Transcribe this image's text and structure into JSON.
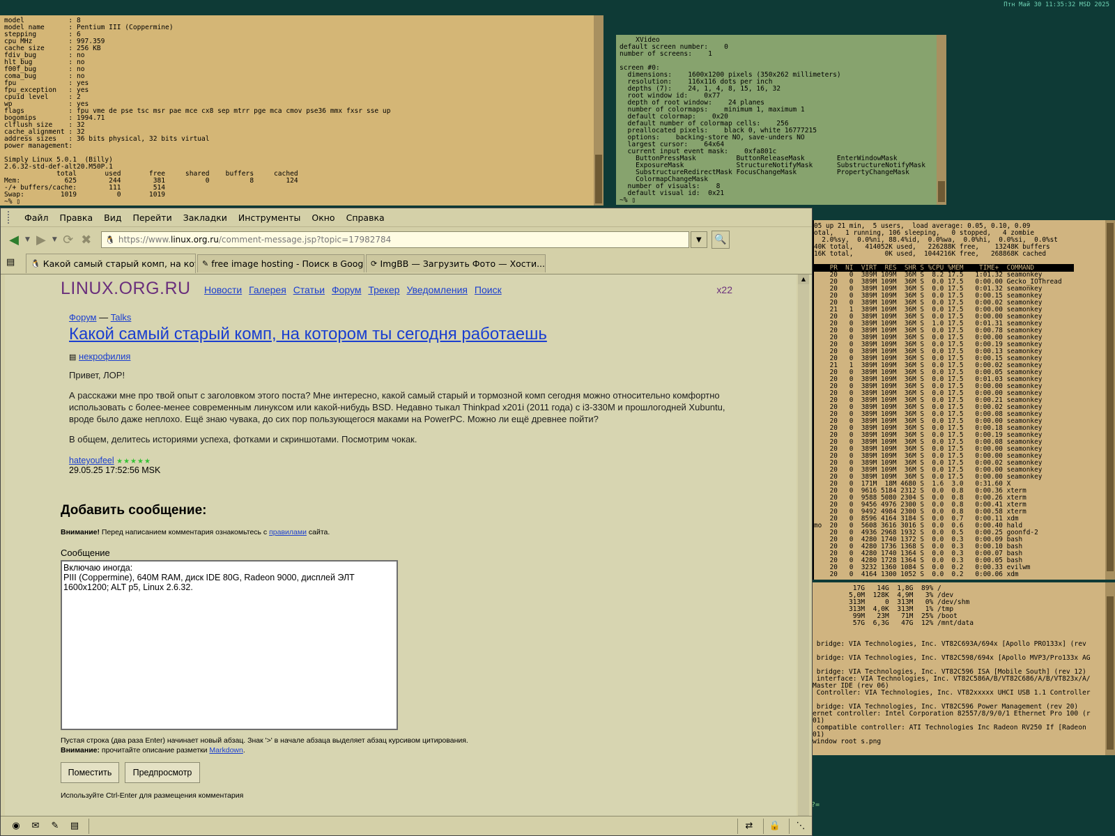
{
  "clock": "Птн Май 30 11:35:32 MSD 2025",
  "term_cpuinfo": {
    "lines": [
      "model           : 8",
      "model name      : Pentium III (Coppermine)",
      "stepping        : 6",
      "cpu MHz         : 997.359",
      "cache size      : 256 KB",
      "fdiv_bug        : no",
      "hlt_bug         : no",
      "f00f_bug        : no",
      "coma_bug        : no",
      "fpu             : yes",
      "fpu_exception   : yes",
      "cpuid level     : 2",
      "wp              : yes",
      "flags           : fpu vme de pse tsc msr pae mce cx8 sep mtrr pge mca cmov pse36 mmx fxsr sse up",
      "bogomips        : 1994.71",
      "clflush size    : 32",
      "cache_alignment : 32",
      "address sizes   : 36 bits physical, 32 bits virtual",
      "power management:",
      "",
      "Simply Linux 5.0.1  (Billy)",
      "2.6.32-std-def-alt20.M50P.1",
      "             total       used       free     shared    buffers     cached",
      "Mem:           625        244        381          0          8        124",
      "-/+ buffers/cache:        111        514",
      "Swap:         1019          0       1019",
      "~% ▯"
    ]
  },
  "term_xdpyinfo": {
    "lines": [
      "    XVideo",
      "default screen number:    0",
      "number of screens:    1",
      "",
      "screen #0:",
      "  dimensions:    1600x1200 pixels (350x262 millimeters)",
      "  resolution:    116x116 dots per inch",
      "  depths (7):    24, 1, 4, 8, 15, 16, 32",
      "  root window id:    0x77",
      "  depth of root window:    24 planes",
      "  number of colormaps:    minimum 1, maximum 1",
      "  default colormap:    0x20",
      "  default number of colormap cells:    256",
      "  preallocated pixels:    black 0, white 16777215",
      "  options:    backing-store NO, save-unders NO",
      "  largest cursor:    64x64",
      "  current input event mask:    0xfa801c",
      "    ButtonPressMask          ButtonReleaseMask        EnterWindowMask",
      "    ExposureMask             StructureNotifyMask      SubstructureNotifyMask",
      "    SubstructureRedirectMask FocusChangeMask          PropertyChangeMask",
      "    ColormapChangeMask",
      "  number of visuals:    8",
      "  default visual id:  0x21",
      "~% ▯"
    ]
  },
  "term_top": {
    "summary": [
      "05 up 21 min,  5 users,  load average: 0.05, 0.10, 0.09",
      "otal,   1 running, 106 sleeping,   0 stopped,   4 zombie",
      "  2.0%sy,  0.0%ni, 88.4%id,  0.0%wa,  0.0%hi,  0.0%si,  0.0%st",
      "40K total,   414052K used,   226288K free,    13248K buffers",
      "16K total,        0K used,  1044216K free,   268868K cached",
      ""
    ],
    "header": "    PR  NI  VIRT  RES  SHR S %CPU %MEM    TIME+  COMMAND          ",
    "rows": [
      "    20   0  389M 109M  36M S  8.2 17.5   1:01.32 seamonkey",
      "    20   0  389M 109M  36M S  0.0 17.5   0:00.00 Gecko_IOThread",
      "    20   0  389M 109M  36M S  0.0 17.5   0:01.32 seamonkey",
      "    20   0  389M 109M  36M S  0.0 17.5   0:00.15 seamonkey",
      "    20   0  389M 109M  36M S  0.0 17.5   0:00.02 seamonkey",
      "    21   1  389M 109M  36M S  0.0 17.5   0:00.00 seamonkey",
      "    20   0  389M 109M  36M S  0.0 17.5   0:00.00 seamonkey",
      "    20   0  389M 109M  36M S  1.0 17.5   0:01.31 seamonkey",
      "    20   0  389M 109M  36M S  0.0 17.5   0:00.78 seamonkey",
      "    20   0  389M 109M  36M S  0.0 17.5   0:00.00 seamonkey",
      "    20   0  389M 109M  36M S  0.0 17.5   0:00.19 seamonkey",
      "    20   0  389M 109M  36M S  0.0 17.5   0:00.13 seamonkey",
      "    20   0  389M 109M  36M S  0.0 17.5   0:00.15 seamonkey",
      "    21   1  389M 109M  36M S  0.0 17.5   0:00.02 seamonkey",
      "    20   0  389M 109M  36M S  0.0 17.5   0:00.05 seamonkey",
      "    20   0  389M 109M  36M S  0.0 17.5   0:01.03 seamonkey",
      "    20   0  389M 109M  36M S  0.0 17.5   0:00.00 seamonkey",
      "    20   0  389M 109M  36M S  0.0 17.5   0:00.00 seamonkey",
      "    20   0  389M 109M  36M S  0.0 17.5   0:00.21 seamonkey",
      "    20   0  389M 109M  36M S  0.0 17.5   0:00.02 seamonkey",
      "    20   0  389M 109M  36M S  0.0 17.5   0:00.08 seamonkey",
      "    20   0  389M 109M  36M S  0.0 17.5   0:00.00 seamonkey",
      "    20   0  389M 109M  36M S  0.0 17.5   0:00.18 seamonkey",
      "    20   0  389M 109M  36M S  0.0 17.5   0:00.19 seamonkey",
      "    20   0  389M 109M  36M S  0.0 17.5   0:00.08 seamonkey",
      "    20   0  389M 109M  36M S  0.0 17.5   0:00.00 seamonkey",
      "    20   0  389M 109M  36M S  0.0 17.5   0:00.00 seamonkey",
      "    20   0  389M 109M  36M S  0.0 17.5   0:00.02 seamonkey",
      "    20   0  389M 109M  36M S  0.0 17.5   0:00.00 seamonkey",
      "    20   0  389M 109M  36M S  0.0 17.5   0:00.00 seamonkey",
      "    20   0  171M  18M 4680 S  1.6  3.0   0:31.60 X",
      "    20   0  9616 5184 2312 S  0.0  0.8   0:00.36 xterm",
      "    20   0  9588 5080 2304 S  0.0  0.8   0:00.26 xterm",
      "    20   0  9456 4976 2300 S  0.0  0.8   0:00.41 xterm",
      "    20   0  9492 4984 2300 S  0.0  0.8   0:00.58 xterm",
      "    20   0  8596 4164 3184 S  0.0  0.7   0:00.11 xdm",
      "mo  20   0  5608 3616 3016 S  0.0  0.6   0:00.40 hald",
      "    20   0  4936 2968 1932 S  0.0  0.5   0:00.25 goonfd-2",
      "    20   0  4280 1740 1372 S  0.0  0.3   0:00.09 bash",
      "    20   0  4280 1736 1368 S  0.0  0.3   0:00.10 bash",
      "    20   0  4280 1740 1364 S  0.0  0.3   0:00.07 bash",
      "    20   0  4280 1728 1364 S  0.0  0.3   0:00.05 bash",
      "    20   0  3232 1360 1084 S  0.0  0.2   0:00.33 evilwm",
      "    20   0  4164 1300 1052 S  0.0  0.2   0:00.06 xdm"
    ]
  },
  "term_misc": {
    "lines": [
      "          17G   14G  1,8G  89% /",
      "         5,0M  128K  4,9M   3% /dev",
      "         313M     0  313M   0% /dev/shm",
      "         313M  4,0K  313M   1% /tmp",
      "          99M   23M   71M  25% /boot",
      "          57G  6,3G   47G  12% /mnt/data",
      "",
      "",
      " bridge: VIA Technologies, Inc. VT82C693A/694x [Apollo PRO133x] (rev",
      "",
      " bridge: VIA Technologies, Inc. VT82C598/694x [Apollo MVP3/Pro133x AG",
      "",
      " bridge: VIA Technologies, Inc. VT82C596 ISA [Mobile South] (rev 12)",
      " interface: VIA Technologies, Inc. VT82C586A/B/VT82C686/A/B/VT823x/A/",
      "Master IDE (rev 06)",
      " Controller: VIA Technologies, Inc. VT82xxxxx UHCI USB 1.1 Controller",
      "",
      " bridge: VIA Technologies, Inc. VT82C596 Power Management (rev 20)",
      "ernet controller: Intel Corporation 82557/8/9/0/1 Ethernet Pro 100 (r",
      "01)",
      " compatible controller: ATI Technologies Inc Radeon RV250 If [Radeon",
      "01)",
      "window root s.png"
    ]
  },
  "bg_prompt": "==?=",
  "browser": {
    "menu": [
      "Файл",
      "Правка",
      "Вид",
      "Перейти",
      "Закладки",
      "Инструменты",
      "Окно",
      "Справка"
    ],
    "url_prefix": "https://www.",
    "url_domain": "linux.org.ru",
    "url_rest": "/comment-message.jsp?topic=17982784",
    "tabs": [
      {
        "label": "Какой самый старый комп, на кот..."
      },
      {
        "label": "free image hosting - Поиск в Google"
      },
      {
        "label": "ImgBB — Загрузить Фото — Хости..."
      }
    ]
  },
  "page": {
    "logo": "LINUX.ORG.RU",
    "nav": [
      "Новости",
      "Галерея",
      "Статьи",
      "Форум",
      "Трекер",
      "Уведомления",
      "Поиск"
    ],
    "counter": "x22",
    "crumb_forum": "Форум",
    "crumb_sep": " — ",
    "crumb_section": "Talks",
    "title": "Какой самый старый комп, на котором ты сегодня работаешь",
    "tag": "некрофилия",
    "paragraphs": [
      "Привет, ЛОР!",
      "А расскажи мне про твой опыт с заголовком этого поста? Мне интересно, какой самый старый и тормозной комп сегодня можно относительно комфортно использовать с более-менее современным линуксом или какой-нибудь BSD. Недавно тыкал Thinkpad x201i (2011 года) с i3-330M и прошлогодней Xubuntu, вроде было даже неплохо. Ещё знаю чувака, до сих пор пользующегося маками на PowerPC. Можно ли ещё древнее пойти?",
      "В общем, делитесь историями успеха, фотками и скриншотами. Посмотрим чокак."
    ],
    "author": "hateyoufeel",
    "stars": "★★★★★",
    "date": "29.05.25 17:52:56 MSK",
    "add_title": "Добавить сообщение:",
    "warn_bold": "Внимание!",
    "warn_text": " Перед написанием комментария ознакомьтесь с ",
    "warn_link": "правилами",
    "warn_tail": " сайта.",
    "msg_label": "Сообщение",
    "msg_lines": [
      "Включаю иногда:",
      "PIII (Coppermine), 640M RAM, диск IDE 80G, Radeon 9000, дисплей ЭЛТ",
      "1600x1200; ALT p5, Linux 2.6.32."
    ],
    "hint1": "Пустая строка (два раза Enter) начинает новый абзац. Знак '>' в начале абзаца выделяет абзац курсивом цитирования.",
    "hint2_bold": "Внимание:",
    "hint2_text": " прочитайте описание разметки ",
    "hint2_link": "Markdown",
    "hint2_tail": ".",
    "btn_post": "Поместить",
    "btn_preview": "Предпросмотр",
    "ctrl_hint": "Используйте Ctrl-Enter для размещения комментария"
  }
}
